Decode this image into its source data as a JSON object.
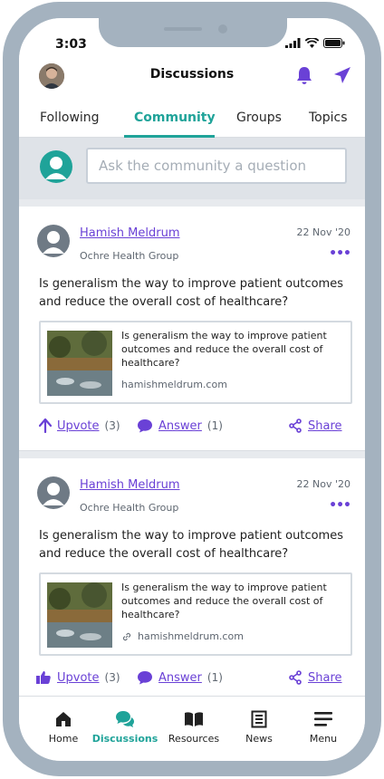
{
  "status_bar": {
    "time": "3:03"
  },
  "header": {
    "title": "Discussions"
  },
  "tabs": [
    {
      "label": "Following"
    },
    {
      "label": "Community"
    },
    {
      "label": "Groups"
    },
    {
      "label": "Topics"
    }
  ],
  "active_tab": "Community",
  "ask": {
    "placeholder": "Ask the community a question"
  },
  "posts": [
    {
      "author": "Hamish Meldrum",
      "organization": "Ochre Health Group",
      "date": "22 Nov '20",
      "text": "Is generalism the way to improve patient outcomes and reduce the overall cost of healthcare?",
      "link": {
        "title": "Is generalism the way to improve patient outcomes and reduce the overall cost of healthcare?",
        "url": "hamishmeldrum.com",
        "url_icon": "none"
      },
      "actions": {
        "upvote_label": "Upvote",
        "upvote_count": "(3)",
        "upvote_icon": "arrow-up-icon",
        "answer_label": "Answer",
        "answer_count": "(1)",
        "share_label": "Share"
      }
    },
    {
      "author": "Hamish Meldrum",
      "organization": "Ochre Health Group",
      "date": "22 Nov '20",
      "text": "Is generalism the way to improve patient outcomes and reduce the overall cost of healthcare?",
      "link": {
        "title": "Is generalism the way to improve patient outcomes and reduce the overall cost of healthcare?",
        "url": "hamishmeldrum.com",
        "url_icon": "link-icon"
      },
      "actions": {
        "upvote_label": "Upvote",
        "upvote_count": "(3)",
        "upvote_icon": "thumbs-up-icon",
        "answer_label": "Answer",
        "answer_count": "(1)",
        "share_label": "Share"
      }
    }
  ],
  "bottom_nav": [
    {
      "label": "Home",
      "icon": "home-icon"
    },
    {
      "label": "Discussions",
      "icon": "chat-icon"
    },
    {
      "label": "Resources",
      "icon": "book-icon"
    },
    {
      "label": "News",
      "icon": "news-icon"
    },
    {
      "label": "Menu",
      "icon": "menu-icon"
    }
  ],
  "active_nav": "Discussions",
  "colors": {
    "accent": "#6a41d6",
    "teal": "#1fa399",
    "frame": "#a4b2bf"
  }
}
